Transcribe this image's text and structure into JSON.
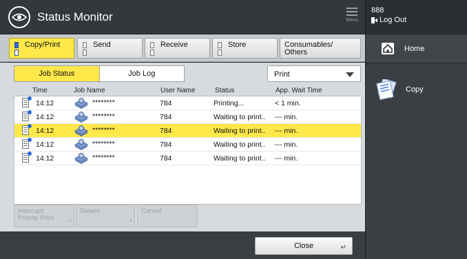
{
  "titlebar": {
    "title": "Status Monitor",
    "menu_label": "Menu"
  },
  "categories": [
    {
      "line1": "Copy/Print",
      "line2": "",
      "active": true
    },
    {
      "line1": "Send",
      "line2": "",
      "active": false
    },
    {
      "line1": "Receive",
      "line2": "",
      "active": false
    },
    {
      "line1": "Store",
      "line2": "",
      "active": false
    },
    {
      "line1": "Consumables/",
      "line2": "Others",
      "active": false
    }
  ],
  "subtabs": {
    "job_status": "Job Status",
    "job_log": "Job Log"
  },
  "filter": {
    "selected": "Print"
  },
  "table": {
    "headers": {
      "time": "Time",
      "job_name": "Job Name",
      "user_name": "User Name",
      "status": "Status",
      "wait": "App. Wait Time"
    },
    "rows": [
      {
        "time": "14:12",
        "job_name": "********",
        "user_name": "784",
        "status": "Printing...",
        "wait": "< 1 min.",
        "selected": false
      },
      {
        "time": "14:12",
        "job_name": "********",
        "user_name": "784",
        "status": "Waiting to print..",
        "wait": "--- min.",
        "selected": false
      },
      {
        "time": "14:12",
        "job_name": "********",
        "user_name": "784",
        "status": "Waiting to print..",
        "wait": "--- min.",
        "selected": true
      },
      {
        "time": "14:12",
        "job_name": "********",
        "user_name": "784",
        "status": "Waiting to print..",
        "wait": "--- min.",
        "selected": false
      },
      {
        "time": "14:12",
        "job_name": "********",
        "user_name": "784",
        "status": "Waiting to print..",
        "wait": "--- min.",
        "selected": false
      }
    ]
  },
  "actions": {
    "interrupt_line1": "Interrupt/",
    "interrupt_line2": "Priority Print",
    "details": "Details",
    "cancel": "Cancel"
  },
  "close_label": "Close",
  "sidebar": {
    "user_id": "888",
    "logout": "Log Out",
    "home": "Home",
    "app_copy": "Copy"
  },
  "colors": {
    "accent": "#ffe84a",
    "panel": "#d8dbde",
    "dark": "#3b3f44"
  }
}
